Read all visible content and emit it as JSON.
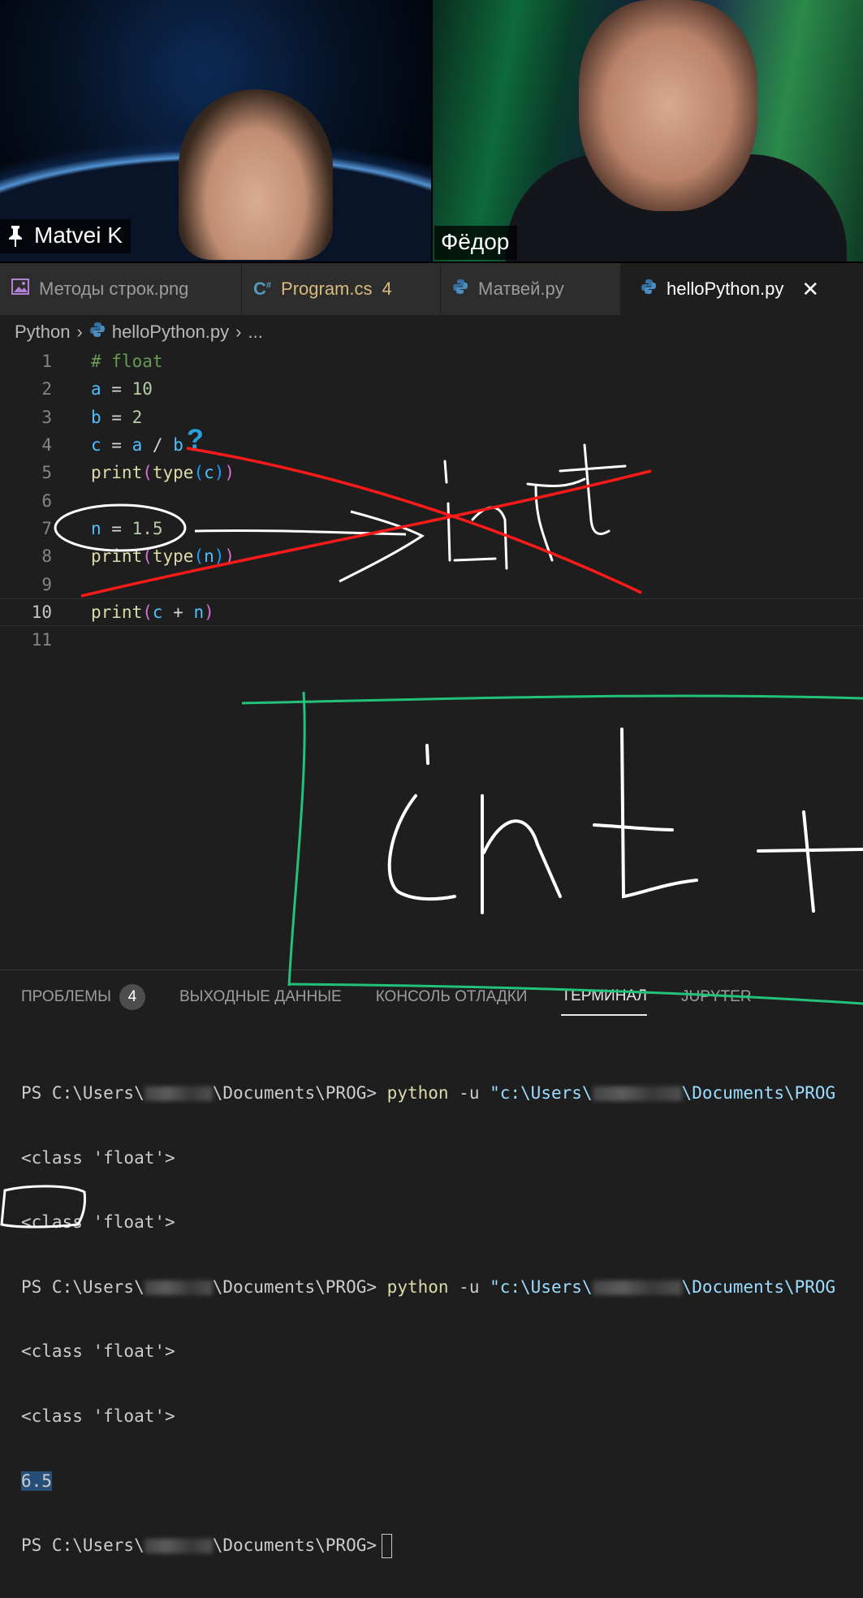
{
  "video": {
    "left_name": "Matvei K",
    "right_name": "Фёдор"
  },
  "tabs": [
    {
      "label": "Методы строк.png",
      "badge": ""
    },
    {
      "label": "Program.cs",
      "badge": "4"
    },
    {
      "label": "Матвей.py",
      "badge": ""
    },
    {
      "label": "helloPython.py",
      "badge": ""
    }
  ],
  "breadcrumb": {
    "folder": "Python",
    "file": "helloPython.py",
    "more": "..."
  },
  "code": {
    "line_numbers": [
      "1",
      "2",
      "3",
      "4",
      "5",
      "6",
      "7",
      "8",
      "9",
      "10",
      "11"
    ],
    "l1": "# float",
    "l2": {
      "var": "a",
      "op": " = ",
      "num": "10"
    },
    "l3": {
      "var": "b",
      "op": " = ",
      "num": "2"
    },
    "l4": {
      "v1": "c",
      "op1": " = ",
      "v2": "a",
      "op2": " / ",
      "v3": "b"
    },
    "l5": {
      "fn1": "print",
      "o": "(",
      "fn2": "type",
      "o2": "(",
      "v": "c",
      "c2": ")",
      "c1": ")"
    },
    "l7": {
      "var": "n",
      "op": " = ",
      "num": "1.5"
    },
    "l8": {
      "fn1": "print",
      "o": "(",
      "fn2": "type",
      "o2": "(",
      "v": "n",
      "c2": ")",
      "c1": ")"
    },
    "l10": {
      "fn": "print",
      "o": "(",
      "v1": "c",
      "op": " + ",
      "v2": "n",
      "c": ")"
    }
  },
  "panel": {
    "tabs": [
      {
        "label": "ПРОБЛЕМЫ",
        "badge": "4"
      },
      {
        "label": "ВЫХОДНЫЕ ДАННЫЕ"
      },
      {
        "label": "КОНСОЛЬ ОТЛАДКИ"
      },
      {
        "label": "ТЕРМИНАЛ"
      },
      {
        "label": "JUPYTER"
      }
    ],
    "terminal": {
      "prompt_start": "PS C:\\Users\\",
      "prompt_end": "\\Documents\\PROG>",
      "cmd": "python",
      "flag": " -u ",
      "path_start": "\"c:\\Users\\",
      "path_end": "\\Documents\\PROG",
      "class_float": "<class 'float'>",
      "result": "6.5"
    }
  },
  "annotations": {
    "question_mark": "?",
    "word_top": "int",
    "word_box": "int +"
  }
}
